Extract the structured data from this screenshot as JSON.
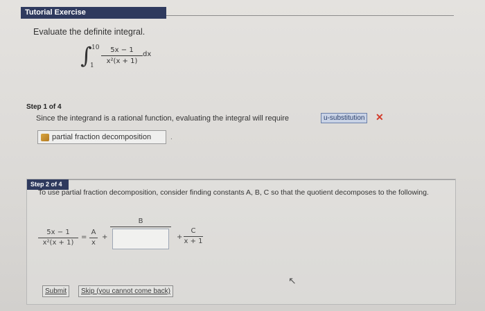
{
  "header": {
    "title": "Tutorial Exercise"
  },
  "prompt": "Evaluate the definite integral.",
  "integral": {
    "symbol": "∫",
    "upper": "10",
    "lower": "1",
    "numerator": "5x − 1",
    "denominator": "x²(x + 1)",
    "differential": "dx"
  },
  "step1": {
    "label": "Step 1 of 4",
    "text": "Since the integrand is a rational function, evaluating the integral will require",
    "submitted_answer": "u-substitution",
    "wrong_mark": "✕",
    "correct_answer": "partial fraction decomposition",
    "trailing": "."
  },
  "step2": {
    "label": "Step 2 of 4",
    "text": "To use partial fraction decomposition, consider finding constants A, B, C so that the quotient decomposes to the following.",
    "lhs_num": "5x − 1",
    "lhs_den": "x²(x + 1)",
    "eq": "=",
    "a_num": "A",
    "a_den": "x",
    "plus": "+",
    "b_num": "B",
    "b_value": "",
    "c_num": "C",
    "c_den": "x + 1",
    "submit_label": "Submit",
    "skip_label": "Skip (you cannot come back)"
  },
  "icons": {
    "cursor": "↖",
    "pencil": "pencil-icon"
  },
  "colors": {
    "header_bg": "#2f3a5e",
    "wrong": "#d23a2a",
    "answer_bg": "#c9d3e6"
  }
}
